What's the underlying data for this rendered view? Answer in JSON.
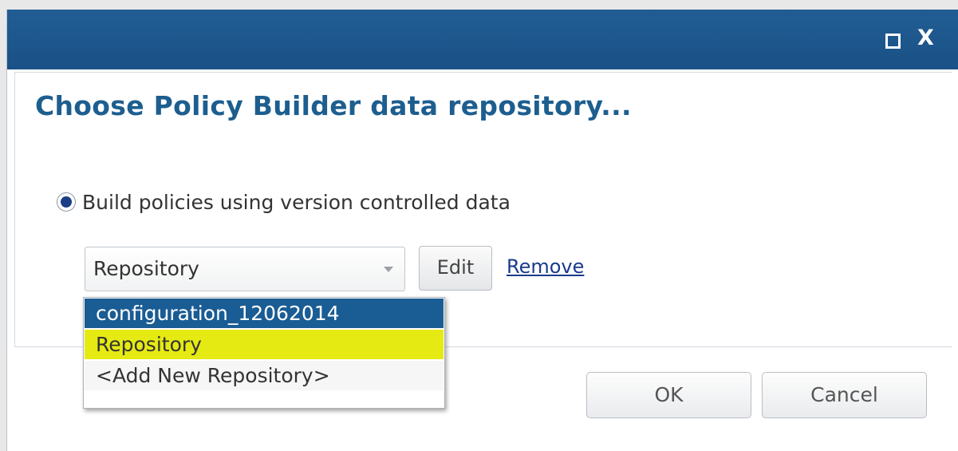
{
  "dialog": {
    "title_controls": {
      "maximize_icon": "maximize-icon",
      "close_icon": "close-icon",
      "close_glyph": "X"
    },
    "heading": "Choose Policy Builder data repository...",
    "radio": {
      "label": "Build policies using version controlled data",
      "checked": true
    },
    "repository_select": {
      "value": "Repository",
      "options": [
        "configuration_12062014",
        "Repository",
        "<Add New Repository>"
      ],
      "highlighted_option": "Repository"
    },
    "edit_label": "Edit",
    "remove_label": "Remove",
    "ok_label": "OK",
    "cancel_label": "Cancel"
  },
  "colors": {
    "titlebar": "#1f5a8f",
    "heading": "#1d5e8f",
    "selected_option": "#1a5c94",
    "highlighted_option": "#e6ea13",
    "link": "#1a3b8c"
  }
}
